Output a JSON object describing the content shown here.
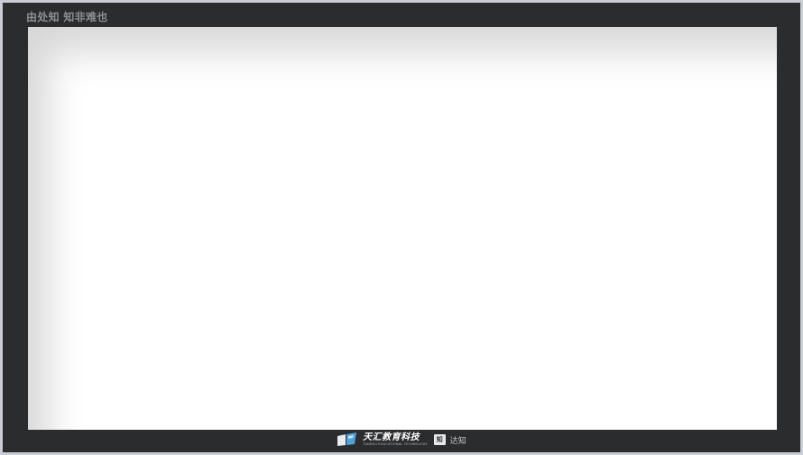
{
  "window": {
    "title": "由处知 知非难也"
  },
  "footer": {
    "brand_name": "天汇教育科技",
    "brand_subtitle": "TIANHUI EDUCATIONAL TECHNOLOGY",
    "badge_text": "知",
    "partner_text": "达知",
    "icon": "book-icon"
  }
}
